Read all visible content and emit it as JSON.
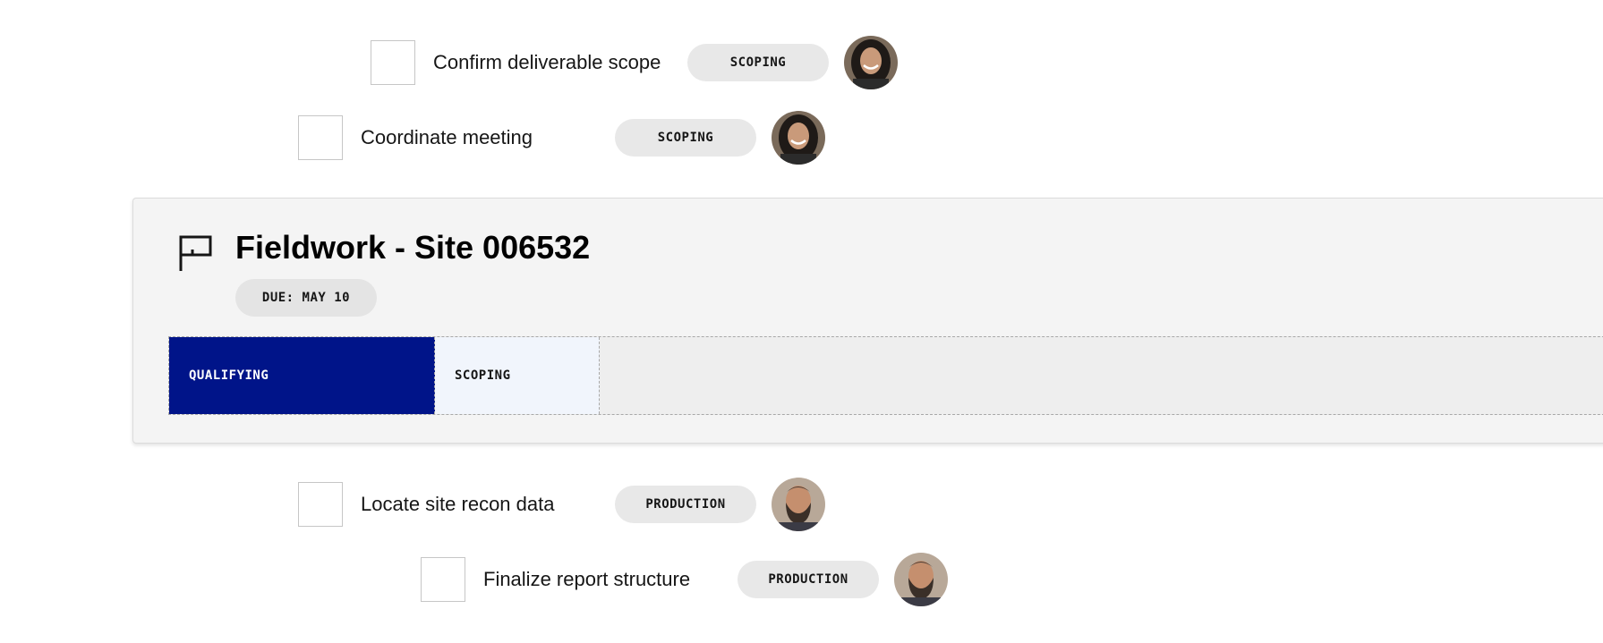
{
  "tasks_above": [
    {
      "label": "Confirm deliverable scope",
      "tag": "SCOPING",
      "assignee": "woman-smiling-avatar"
    },
    {
      "label": "Coordinate meeting",
      "tag": "SCOPING",
      "assignee": "woman-smiling-avatar"
    }
  ],
  "milestone": {
    "icon": "flag-icon",
    "title": "Fieldwork - Site 006532",
    "due": "DUE: MAY 10",
    "stages": [
      {
        "label": "QUALIFYING",
        "state": "active",
        "color": "#001489"
      },
      {
        "label": "SCOPING",
        "state": "next",
        "color": "#f1f5fc"
      },
      {
        "label": "",
        "state": "empty",
        "color": "#eeeeee"
      }
    ]
  },
  "tasks_below": [
    {
      "label": "Locate site recon data",
      "tag": "PRODUCTION",
      "assignee": "bearded-man-avatar"
    },
    {
      "label": "Finalize report structure",
      "tag": "PRODUCTION",
      "assignee": "bearded-man-avatar"
    }
  ],
  "colors": {
    "accent": "#001489",
    "tag_background": "#e8e8e8",
    "card_background": "#f4f4f4"
  }
}
